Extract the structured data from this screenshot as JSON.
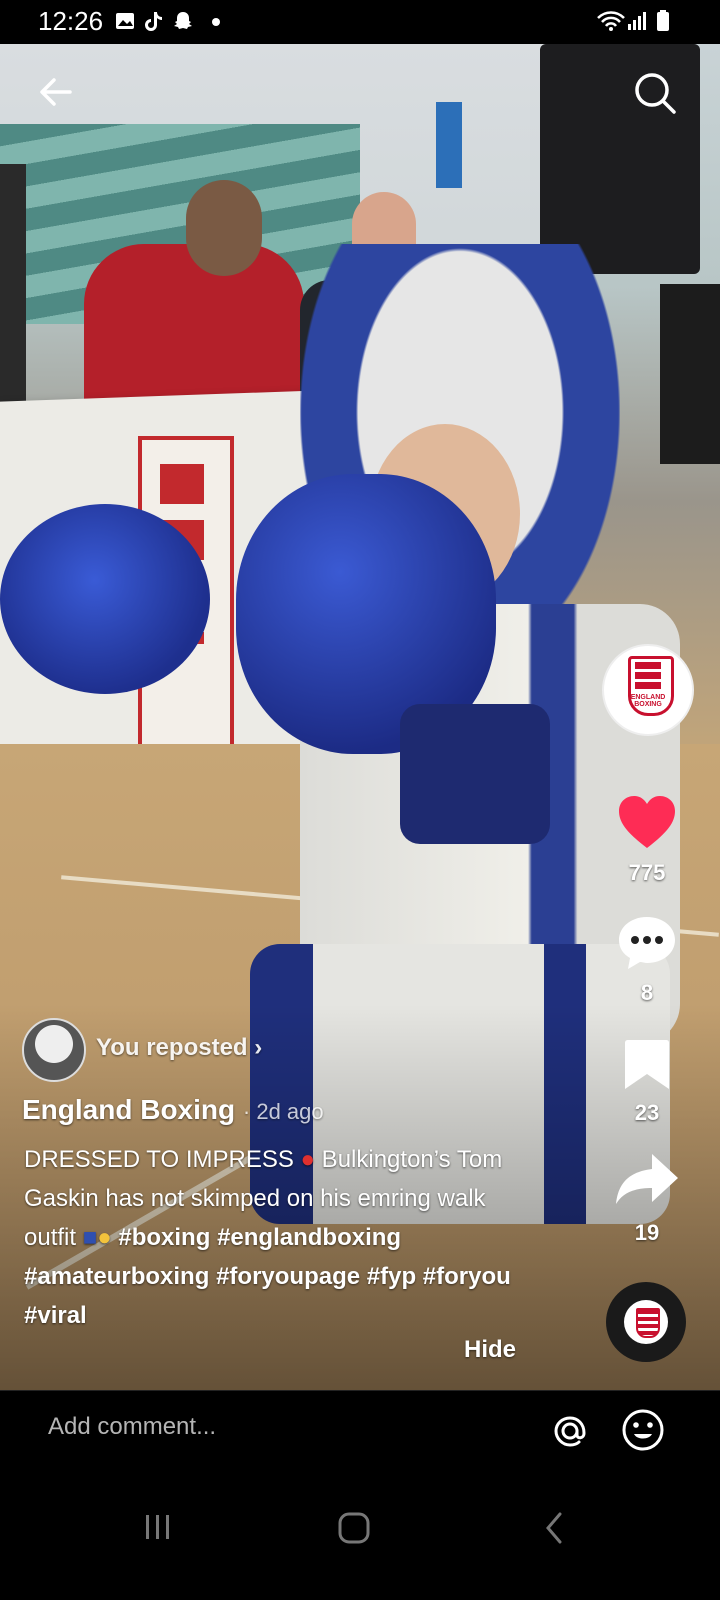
{
  "status_bar": {
    "time": "12:26"
  },
  "video": {
    "author": "England Boxing",
    "time_ago": "· 2d ago",
    "repost_label": "You reposted",
    "caption_text_1": "DRESSED TO IMPRESS ",
    "caption_text_2": " Bulkington’s Tom Gaskin has not skimped on his emring walk outfit ",
    "hashtags": [
      "#boxing",
      "#englandboxing",
      "#amateurboxing",
      "#foryoupage",
      "#fyp",
      "#foryou",
      "#viral"
    ],
    "hide_label": "Hide"
  },
  "rail": {
    "likes": "775",
    "comments": "8",
    "saves": "23",
    "shares": "19",
    "profile_logo_text": "ENGLAND BOXING"
  },
  "comment_bar": {
    "placeholder": "Add comment..."
  },
  "colors": {
    "like": "#fe2c55",
    "background": "#000000"
  }
}
